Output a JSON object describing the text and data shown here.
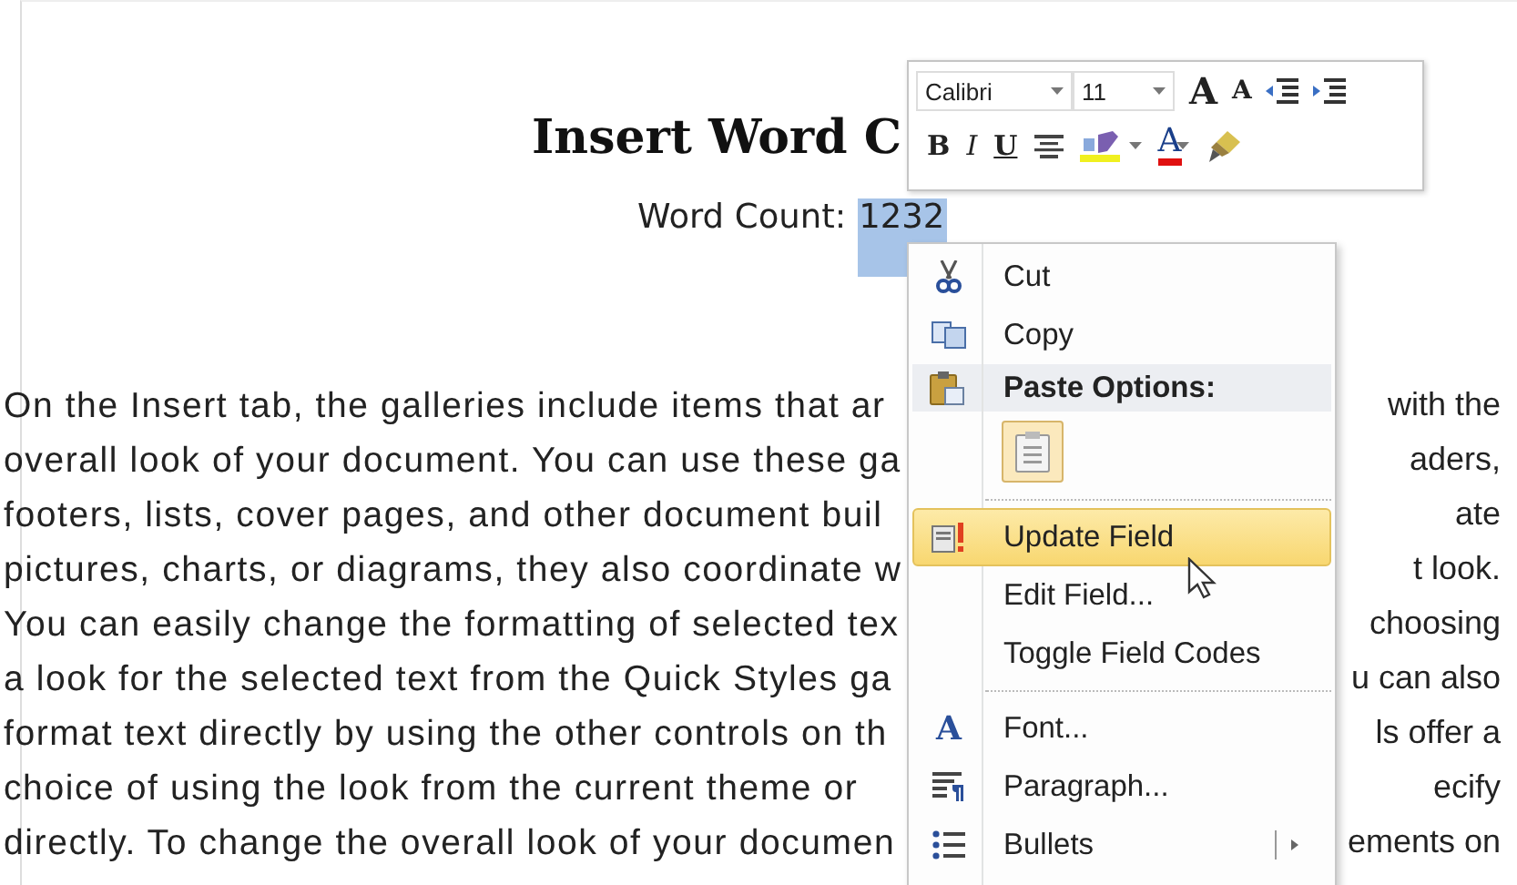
{
  "document": {
    "title": "Insert Word C",
    "word_count_label": "Word Count:",
    "word_count_value": "1232",
    "word_count_selected": true,
    "lines": [
      {
        "left": "On the Insert tab, the galleries include items that ar",
        "right": "with the"
      },
      {
        "left": "overall look of your document. You can use these ga",
        "right": "aders,"
      },
      {
        "left": "footers, lists, cover pages, and other document buil",
        "right": "ate"
      },
      {
        "left": "pictures, charts, or diagrams, they also coordinate w",
        "right": "t look."
      },
      {
        "left": "You can easily change the formatting of selected tex",
        "right": "choosing"
      },
      {
        "left": "a look for the selected text from the Quick Styles ga",
        "right": "u can also"
      },
      {
        "left": "format text directly by using the other controls on th",
        "right": "ls offer a"
      },
      {
        "left": "choice of using the look from the current theme or",
        "right": "ecify"
      },
      {
        "left": "directly. To change the overall look of your documen",
        "right": "ements on"
      }
    ]
  },
  "mini_toolbar": {
    "font": "Calibri",
    "size": "11",
    "row1": [
      {
        "kind": "grow",
        "text": "A"
      },
      {
        "kind": "shrink",
        "text": "A"
      },
      {
        "kind": "outdent"
      },
      {
        "kind": "indent"
      }
    ],
    "row2": [
      {
        "kind": "bold",
        "text": "B"
      },
      {
        "kind": "italic",
        "text": "I"
      },
      {
        "kind": "underline",
        "text": "U"
      },
      {
        "kind": "center"
      },
      {
        "kind": "highlight"
      },
      {
        "kind": "font_color",
        "text": "A"
      },
      {
        "kind": "painter"
      }
    ]
  },
  "context_menu": {
    "items": [
      {
        "kind": "command",
        "label": "Cut",
        "selected": false,
        "submenu": false
      },
      {
        "kind": "command",
        "label": "Copy",
        "selected": false,
        "submenu": false
      },
      {
        "kind": "header",
        "label": "Paste Options:"
      },
      {
        "kind": "paste"
      },
      {
        "kind": "separator"
      },
      {
        "kind": "command",
        "label": "Update Field",
        "selected": true,
        "submenu": false
      },
      {
        "kind": "command",
        "label": "Edit Field...",
        "selected": false,
        "submenu": false
      },
      {
        "kind": "command",
        "label": "Toggle Field Codes",
        "selected": false,
        "submenu": false
      },
      {
        "kind": "separator"
      },
      {
        "kind": "command",
        "label": "Font...",
        "icon_text": "A",
        "selected": false,
        "submenu": false
      },
      {
        "kind": "command",
        "label": "Paragraph...",
        "selected": false,
        "submenu": false
      },
      {
        "kind": "command",
        "label": "Bullets",
        "selected": false,
        "submenu": true
      }
    ]
  }
}
